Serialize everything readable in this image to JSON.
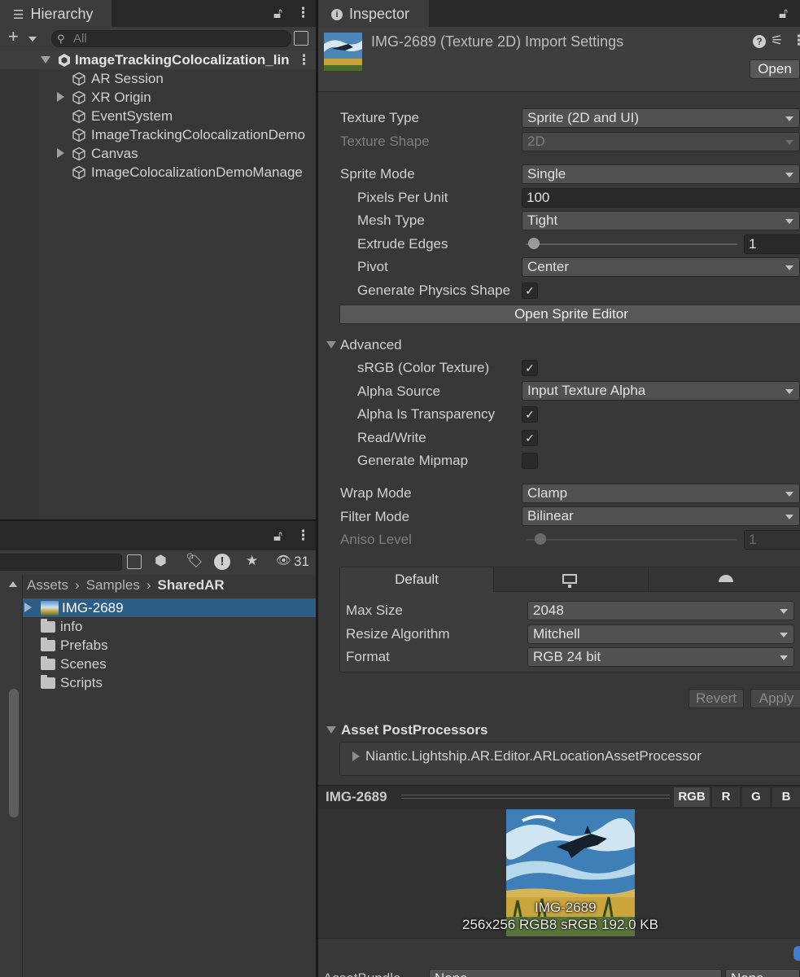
{
  "hierarchy": {
    "tab_title": "Hierarchy",
    "search_placeholder": "All",
    "scene_name": "ImageTrackingColocalization_lin",
    "items": [
      {
        "label": "AR Session",
        "expandable": false
      },
      {
        "label": "XR Origin",
        "expandable": true
      },
      {
        "label": "EventSystem",
        "expandable": false
      },
      {
        "label": "ImageTrackingColocalizationDemo",
        "expandable": false
      },
      {
        "label": "Canvas",
        "expandable": true
      },
      {
        "label": "ImageColocalizationDemoManage",
        "expandable": false
      }
    ]
  },
  "project": {
    "visible_count": "31",
    "breadcrumb": [
      "Assets",
      "Samples",
      "SharedAR"
    ],
    "items": [
      {
        "label": "IMG-2689",
        "type": "texture",
        "selected": true
      },
      {
        "label": "info",
        "type": "folder"
      },
      {
        "label": "Prefabs",
        "type": "folder"
      },
      {
        "label": "Scenes",
        "type": "folder"
      },
      {
        "label": "Scripts",
        "type": "folder"
      }
    ]
  },
  "inspector": {
    "tab_title": "Inspector",
    "asset_title": "IMG-2689 (Texture 2D) Import Settings",
    "open_button": "Open",
    "texture_type": {
      "label": "Texture Type",
      "value": "Sprite (2D and UI)"
    },
    "texture_shape": {
      "label": "Texture Shape",
      "value": "2D"
    },
    "sprite_mode": {
      "label": "Sprite Mode",
      "value": "Single"
    },
    "pixels_per_unit": {
      "label": "Pixels Per Unit",
      "value": "100"
    },
    "mesh_type": {
      "label": "Mesh Type",
      "value": "Tight"
    },
    "extrude_edges": {
      "label": "Extrude Edges",
      "value": "1"
    },
    "pivot": {
      "label": "Pivot",
      "value": "Center"
    },
    "generate_physics_shape": {
      "label": "Generate Physics Shape",
      "checked": true
    },
    "open_sprite_editor": "Open Sprite Editor",
    "advanced": {
      "label": "Advanced",
      "srgb": {
        "label": "sRGB (Color Texture)",
        "checked": true
      },
      "alpha_source": {
        "label": "Alpha Source",
        "value": "Input Texture Alpha"
      },
      "alpha_is_transparency": {
        "label": "Alpha Is Transparency",
        "checked": true
      },
      "read_write": {
        "label": "Read/Write",
        "checked": true
      },
      "generate_mipmap": {
        "label": "Generate Mipmap",
        "checked": false
      }
    },
    "wrap_mode": {
      "label": "Wrap Mode",
      "value": "Clamp"
    },
    "filter_mode": {
      "label": "Filter Mode",
      "value": "Bilinear"
    },
    "aniso_level": {
      "label": "Aniso Level",
      "value": "1"
    },
    "platform": {
      "tabs": [
        "Default",
        "monitor-icon",
        "android-icon"
      ],
      "max_size": {
        "label": "Max Size",
        "value": "2048"
      },
      "resize_algorithm": {
        "label": "Resize Algorithm",
        "value": "Mitchell"
      },
      "format": {
        "label": "Format",
        "value": "RGB 24 bit"
      }
    },
    "revert_button": "Revert",
    "apply_button": "Apply",
    "asset_postprocessors": {
      "label": "Asset PostProcessors",
      "item": "Niantic.Lightship.AR.Editor.ARLocationAssetProcessor"
    },
    "preview": {
      "title": "IMG-2689",
      "channels": [
        "RGB",
        "R",
        "G",
        "B"
      ],
      "image_name": "IMG-2689",
      "image_info": "256x256 RGB8 sRGB  192.0 KB"
    },
    "bottom": {
      "label": "AssetBundle",
      "value1": "None",
      "value2": "None"
    }
  },
  "colors": {
    "panel_bg": "#383838",
    "header_bg": "#282828",
    "selection": "#2c5d87"
  }
}
